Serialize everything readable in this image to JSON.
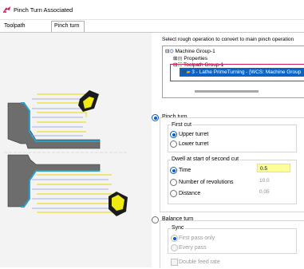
{
  "window": {
    "title": "Pinch Turn Associated"
  },
  "tabs": [
    {
      "label": "Toolpath parameters"
    },
    {
      "label": "Pinch turn"
    }
  ],
  "rough_op": {
    "label": "Select rough operation to convert to main pinch operation",
    "tree": {
      "machine_group": "Machine Group-1",
      "properties": "Properties",
      "toolpath_group": "Toolpath Group-1",
      "operation": "3 - Lathe PrimeTurning - [WCS: Machine Group"
    }
  },
  "pinch_turn": {
    "label": "Pinch turn",
    "first_cut": {
      "label": "First cut",
      "upper": "Upper turret",
      "lower": "Lower turret"
    },
    "dwell": {
      "label": "Dwell at start of second cut",
      "time": {
        "label": "Time",
        "value": "0.5"
      },
      "revolutions": {
        "label": "Number of revolutions",
        "value": "10.0"
      },
      "distance": {
        "label": "Distance",
        "value": "0.05"
      }
    }
  },
  "balance_turn": {
    "label": "Balance turn",
    "sync": {
      "label": "Sync",
      "first_pass": "First pass only",
      "every_pass": "Every pass"
    },
    "double_feed": "Double feed rate"
  }
}
